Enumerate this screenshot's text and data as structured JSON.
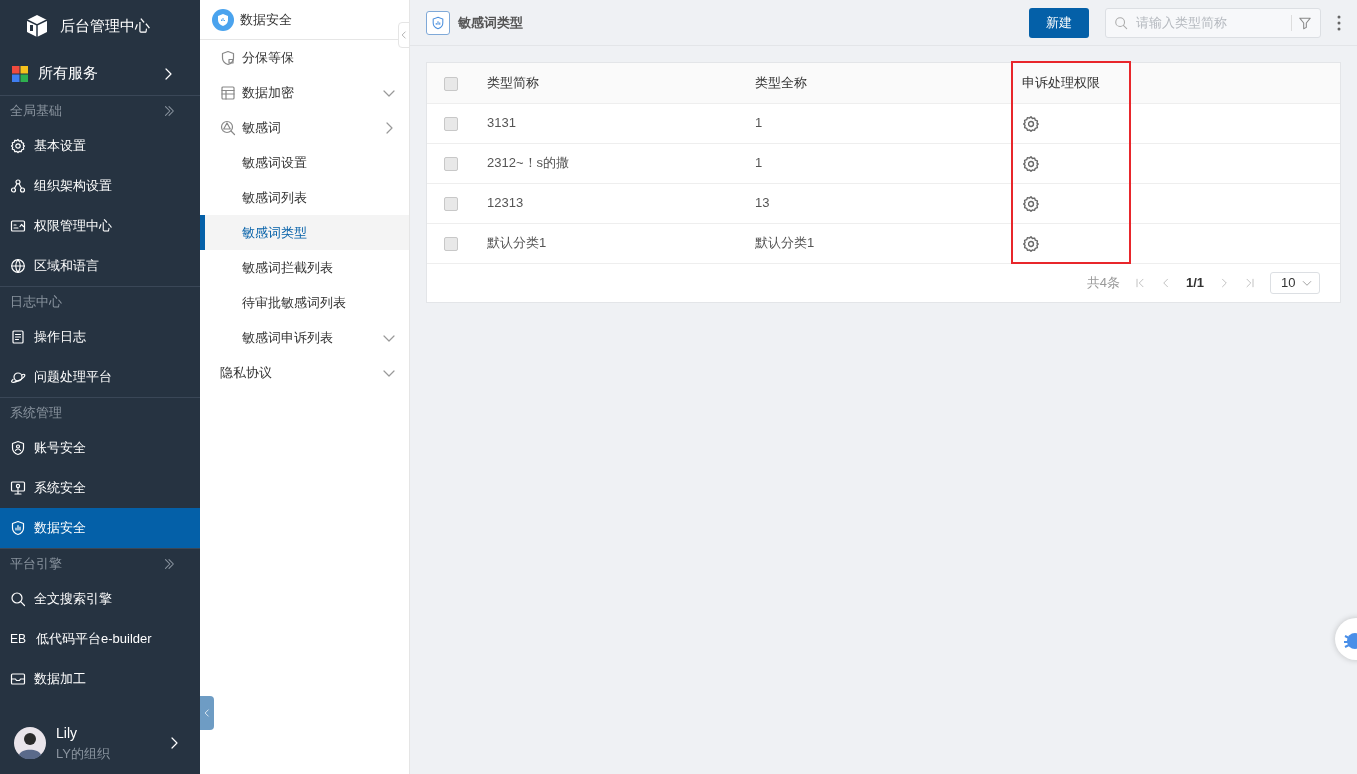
{
  "app": {
    "title": "后台管理中心"
  },
  "all_services": {
    "label": "所有服务"
  },
  "nav_groups": [
    {
      "title": "全局基础",
      "collapsible": true,
      "items": [
        {
          "label": "基本设置",
          "selected": false
        },
        {
          "label": "组织架构设置",
          "selected": false
        },
        {
          "label": "权限管理中心",
          "selected": false
        },
        {
          "label": "区域和语言",
          "selected": false
        }
      ]
    },
    {
      "title": "日志中心",
      "collapsible": false,
      "items": [
        {
          "label": "操作日志",
          "selected": false
        },
        {
          "label": "问题处理平台",
          "selected": false
        }
      ]
    },
    {
      "title": "系统管理",
      "collapsible": false,
      "items": [
        {
          "label": "账号安全",
          "selected": false
        },
        {
          "label": "系统安全",
          "selected": false
        },
        {
          "label": "数据安全",
          "selected": true
        }
      ]
    },
    {
      "title": "平台引擎",
      "collapsible": true,
      "items": [
        {
          "label": "全文搜索引擎",
          "selected": false
        },
        {
          "label": "低代码平台e-builder",
          "selected": false,
          "icon_text": "EB"
        },
        {
          "label": "数据加工",
          "selected": false
        }
      ]
    }
  ],
  "user": {
    "name": "Lily",
    "org": "LY的组织"
  },
  "submenu": {
    "title": "数据安全",
    "items": [
      {
        "label": "分保等保",
        "selected": false
      },
      {
        "label": "数据加密",
        "selected": false,
        "chevron_down": true
      },
      {
        "label": "敏感词",
        "selected": false,
        "chevron_down": false,
        "children": [
          {
            "label": "敏感词设置",
            "selected": false
          },
          {
            "label": "敏感词列表",
            "selected": false
          },
          {
            "label": "敏感词类型",
            "selected": true
          },
          {
            "label": "敏感词拦截列表",
            "selected": false
          },
          {
            "label": "待审批敏感词列表",
            "selected": false
          },
          {
            "label": "敏感词申诉列表",
            "selected": false,
            "chevron_down": true
          }
        ]
      },
      {
        "label": "隐私协议",
        "selected": false,
        "chevron_down": true
      }
    ]
  },
  "page": {
    "title": "敏感词类型",
    "new_button": "新建",
    "search": {
      "placeholder": "请输入类型简称"
    }
  },
  "table": {
    "select_all": false,
    "columns": [
      {
        "label": "类型简称",
        "highlighted": false
      },
      {
        "label": "类型全称",
        "highlighted": false
      },
      {
        "label": "申诉处理权限",
        "highlighted": true
      }
    ],
    "rows": [
      {
        "checked": false,
        "cells": [
          "3131",
          "1"
        ]
      },
      {
        "checked": false,
        "cells": [
          "2312~！s的撒",
          "1"
        ]
      },
      {
        "checked": false,
        "cells": [
          "12313",
          "13"
        ]
      },
      {
        "checked": false,
        "cells": [
          "默认分类1",
          "默认分类1"
        ]
      }
    ]
  },
  "pagination": {
    "total": "共4条",
    "page": "1/1",
    "page_size": "10"
  }
}
